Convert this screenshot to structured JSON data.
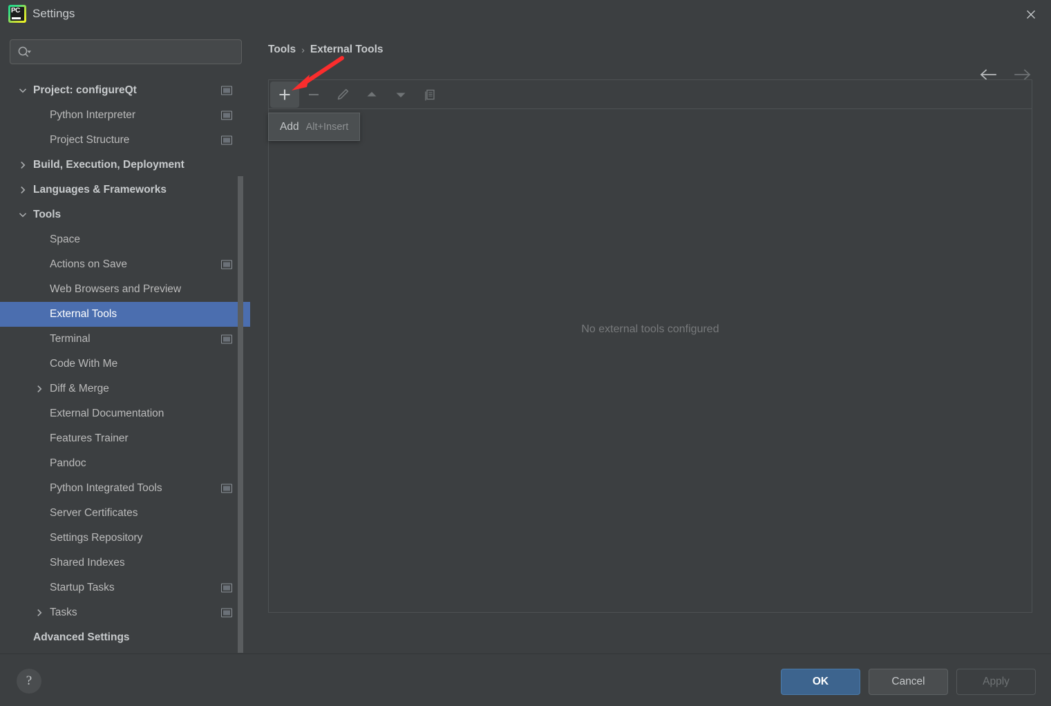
{
  "window": {
    "title": "Settings",
    "app_icon": "pycharm-icon",
    "icon_text": "PC",
    "close_icon": "close-icon"
  },
  "search": {
    "placeholder": "",
    "value": "",
    "icon": "search-icon"
  },
  "sidebar": {
    "items": [
      {
        "label": "Project: configureQt",
        "level": 0,
        "bold": true,
        "chevron": "down",
        "scope_icon": true,
        "selected": false
      },
      {
        "label": "Python Interpreter",
        "level": 1,
        "bold": false,
        "chevron": "none",
        "scope_icon": true,
        "selected": false
      },
      {
        "label": "Project Structure",
        "level": 1,
        "bold": false,
        "chevron": "none",
        "scope_icon": true,
        "selected": false
      },
      {
        "label": "Build, Execution, Deployment",
        "level": 0,
        "bold": true,
        "chevron": "right",
        "scope_icon": false,
        "selected": false
      },
      {
        "label": "Languages & Frameworks",
        "level": 0,
        "bold": true,
        "chevron": "right",
        "scope_icon": false,
        "selected": false
      },
      {
        "label": "Tools",
        "level": 0,
        "bold": true,
        "chevron": "down",
        "scope_icon": false,
        "selected": false
      },
      {
        "label": "Space",
        "level": 1,
        "bold": false,
        "chevron": "none",
        "scope_icon": false,
        "selected": false
      },
      {
        "label": "Actions on Save",
        "level": 1,
        "bold": false,
        "chevron": "none",
        "scope_icon": true,
        "selected": false
      },
      {
        "label": "Web Browsers and Preview",
        "level": 1,
        "bold": false,
        "chevron": "none",
        "scope_icon": false,
        "selected": false
      },
      {
        "label": "External Tools",
        "level": 1,
        "bold": false,
        "chevron": "none",
        "scope_icon": false,
        "selected": true
      },
      {
        "label": "Terminal",
        "level": 1,
        "bold": false,
        "chevron": "none",
        "scope_icon": true,
        "selected": false
      },
      {
        "label": "Code With Me",
        "level": 1,
        "bold": false,
        "chevron": "none",
        "scope_icon": false,
        "selected": false
      },
      {
        "label": "Diff & Merge",
        "level": 1,
        "bold": false,
        "chevron": "right",
        "scope_icon": false,
        "selected": false
      },
      {
        "label": "External Documentation",
        "level": 1,
        "bold": false,
        "chevron": "none",
        "scope_icon": false,
        "selected": false
      },
      {
        "label": "Features Trainer",
        "level": 1,
        "bold": false,
        "chevron": "none",
        "scope_icon": false,
        "selected": false
      },
      {
        "label": "Pandoc",
        "level": 1,
        "bold": false,
        "chevron": "none",
        "scope_icon": false,
        "selected": false
      },
      {
        "label": "Python Integrated Tools",
        "level": 1,
        "bold": false,
        "chevron": "none",
        "scope_icon": true,
        "selected": false
      },
      {
        "label": "Server Certificates",
        "level": 1,
        "bold": false,
        "chevron": "none",
        "scope_icon": false,
        "selected": false
      },
      {
        "label": "Settings Repository",
        "level": 1,
        "bold": false,
        "chevron": "none",
        "scope_icon": false,
        "selected": false
      },
      {
        "label": "Shared Indexes",
        "level": 1,
        "bold": false,
        "chevron": "none",
        "scope_icon": false,
        "selected": false
      },
      {
        "label": "Startup Tasks",
        "level": 1,
        "bold": false,
        "chevron": "none",
        "scope_icon": true,
        "selected": false
      },
      {
        "label": "Tasks",
        "level": 1,
        "bold": false,
        "chevron": "right",
        "scope_icon": true,
        "selected": false
      },
      {
        "label": "Advanced Settings",
        "level": 0,
        "bold": true,
        "chevron": "none",
        "scope_icon": false,
        "selected": false
      }
    ]
  },
  "breadcrumb": {
    "parent": "Tools",
    "separator": "›",
    "current": "External Tools"
  },
  "navigation": {
    "back_icon": "arrow-left-icon",
    "forward_icon": "arrow-right-icon"
  },
  "toolbar": {
    "buttons": [
      {
        "name": "add-button",
        "icon": "plus-icon",
        "enabled": true,
        "hover": true
      },
      {
        "name": "remove-button",
        "icon": "minus-icon",
        "enabled": false,
        "hover": false
      },
      {
        "name": "edit-button",
        "icon": "pencil-icon",
        "enabled": false,
        "hover": false
      },
      {
        "name": "move-up-button",
        "icon": "triangle-up-icon",
        "enabled": false,
        "hover": false
      },
      {
        "name": "move-down-button",
        "icon": "triangle-down-icon",
        "enabled": false,
        "hover": false
      },
      {
        "name": "copy-button",
        "icon": "copy-icon",
        "enabled": false,
        "hover": false
      }
    ]
  },
  "tooltip": {
    "label": "Add",
    "shortcut": "Alt+Insert"
  },
  "main": {
    "empty_message": "No external tools configured"
  },
  "footer": {
    "help_label": "?",
    "ok_label": "OK",
    "cancel_label": "Cancel",
    "apply_label": "Apply"
  },
  "annotation": {
    "type": "red-arrow",
    "color": "#fa2d2d",
    "points_to": "add-button"
  },
  "colors": {
    "background": "#3c3f41",
    "selection": "#4b6eaf",
    "primary_button": "#3d648e",
    "text": "#bbbbbb",
    "accent_red": "#fa2d2d"
  }
}
